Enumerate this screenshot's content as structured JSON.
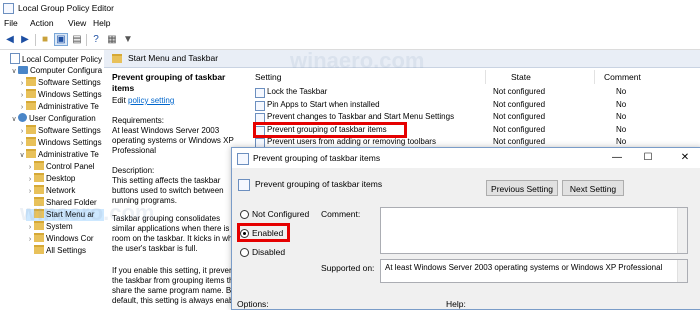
{
  "window": {
    "title": "Local Group Policy Editor"
  },
  "menu": [
    "File",
    "Action",
    "View",
    "Help"
  ],
  "toolbar": {
    "icons": [
      "back-arrow-icon",
      "forward-arrow-icon",
      "folder-up-icon",
      "show-hide-tree-icon",
      "export-icon",
      "help-icon",
      "properties-icon",
      "filter-icon"
    ]
  },
  "tree": [
    {
      "label": "Local Computer Policy",
      "indent": 0,
      "twisty": "",
      "icon": "doc"
    },
    {
      "label": "Computer Configura",
      "indent": 1,
      "twisty": "v",
      "icon": "pc"
    },
    {
      "label": "Software Settings",
      "indent": 2,
      "twisty": ">",
      "icon": "folder"
    },
    {
      "label": "Windows Settings",
      "indent": 2,
      "twisty": ">",
      "icon": "folder"
    },
    {
      "label": "Administrative Te",
      "indent": 2,
      "twisty": ">",
      "icon": "folder"
    },
    {
      "label": "User Configuration",
      "indent": 1,
      "twisty": "v",
      "icon": "user"
    },
    {
      "label": "Software Settings",
      "indent": 2,
      "twisty": ">",
      "icon": "folder"
    },
    {
      "label": "Windows Settings",
      "indent": 2,
      "twisty": ">",
      "icon": "folder"
    },
    {
      "label": "Administrative Te",
      "indent": 2,
      "twisty": "v",
      "icon": "folder"
    },
    {
      "label": "Control Panel",
      "indent": 3,
      "twisty": ">",
      "icon": "folder"
    },
    {
      "label": "Desktop",
      "indent": 3,
      "twisty": ">",
      "icon": "folder"
    },
    {
      "label": "Network",
      "indent": 3,
      "twisty": ">",
      "icon": "folder"
    },
    {
      "label": "Shared Folder",
      "indent": 3,
      "twisty": "",
      "icon": "folder"
    },
    {
      "label": "Start Menu ar",
      "indent": 3,
      "twisty": "",
      "icon": "folder",
      "selected": true
    },
    {
      "label": "System",
      "indent": 3,
      "twisty": ">",
      "icon": "folder"
    },
    {
      "label": "Windows Cor",
      "indent": 3,
      "twisty": ">",
      "icon": "folder"
    },
    {
      "label": "All Settings",
      "indent": 3,
      "twisty": "",
      "icon": "folder"
    }
  ],
  "pane": {
    "header": "Start Menu and Taskbar"
  },
  "description": {
    "title": "Prevent grouping of taskbar items",
    "edit_prefix": "Edit ",
    "edit_link": "policy setting",
    "requirements": "Requirements:\nAt least Windows Server 2003 operating systems or Windows XP Professional",
    "desc": "Description:\nThis setting affects the taskbar buttons used to switch between running programs.",
    "para2": "Taskbar grouping consolidates similar applications when there is no room on the taskbar. It kicks in when the user's taskbar is full.",
    "para3": "If you enable this setting, it prevents the taskbar from grouping items that share the same program name. By default, this setting is always enab"
  },
  "list": {
    "columns": [
      "Setting",
      "State",
      "Comment"
    ],
    "rows": [
      {
        "setting": "Lock the Taskbar",
        "state": "Not configured",
        "comment": "No"
      },
      {
        "setting": "Pin Apps to Start when installed",
        "state": "Not configured",
        "comment": "No"
      },
      {
        "setting": "Prevent changes to Taskbar and Start Menu Settings",
        "state": "Not configured",
        "comment": "No"
      },
      {
        "setting": "Prevent grouping of taskbar items",
        "state": "Not configured",
        "comment": "No"
      },
      {
        "setting": "Prevent users from adding or removing toolbars",
        "state": "Not configured",
        "comment": "No"
      }
    ]
  },
  "dialog": {
    "title": "Prevent grouping of taskbar items",
    "subtitle": "Prevent grouping of taskbar items",
    "prev_button": "Previous Setting",
    "next_button": "Next Setting",
    "radio_not_configured": "Not Configured",
    "radio_enabled": "Enabled",
    "radio_disabled": "Disabled",
    "selected": "Enabled",
    "comment_label": "Comment:",
    "comment_value": "",
    "supported_label": "Supported on:",
    "supported_value": "At least Windows Server 2003 operating systems or Windows XP Professional",
    "options_label": "Options:",
    "help_label": "Help:"
  },
  "watermark": "winaero.com",
  "colors": {
    "highlight": "#e50000",
    "selection": "#cde8ff",
    "link": "#0066cc"
  }
}
